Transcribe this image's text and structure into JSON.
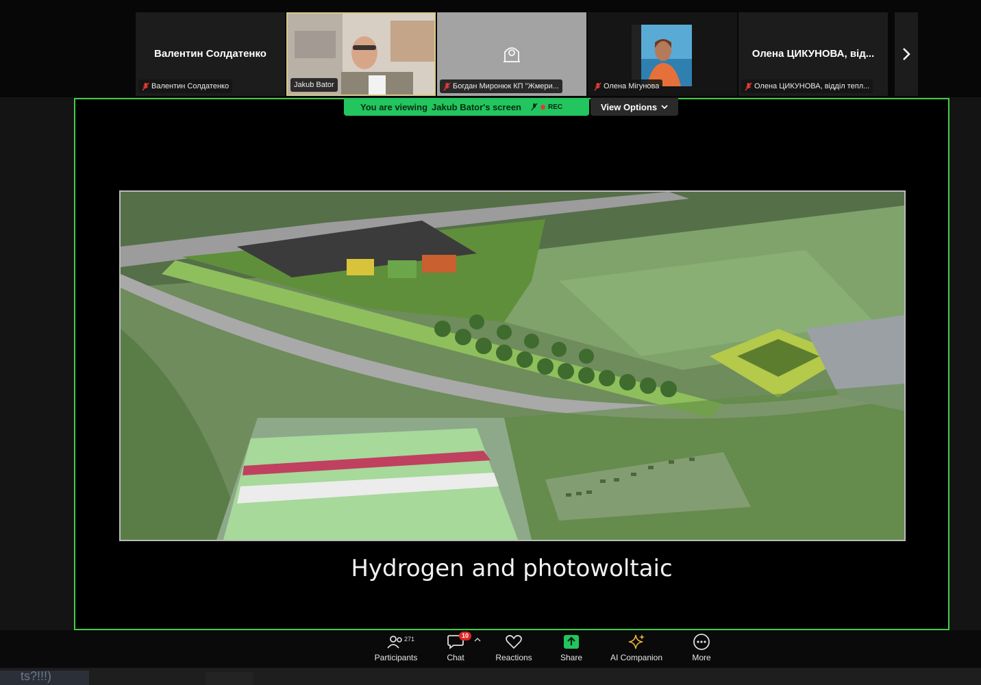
{
  "participants": [
    {
      "big_name": "Валентин Солдатенко",
      "label": "Валентин Солдатенко",
      "muted": true,
      "has_video": false
    },
    {
      "big_name": "",
      "label": "Jakub Bator",
      "muted": false,
      "has_video": true,
      "active": true
    },
    {
      "big_name": "",
      "label": "Богдан Миронюк КП \"Жмери...",
      "muted": true,
      "has_video": false
    },
    {
      "big_name": "",
      "label": "Олена Мігунова",
      "muted": true,
      "has_video": true
    },
    {
      "big_name": "Олена ЦИКУНОВА, від...",
      "label": "Олена ЦИКУНОВА, відділ тепл...",
      "muted": true,
      "has_video": false
    }
  ],
  "share_bar": {
    "viewing": "You are viewing",
    "who": "Jakub Bator's screen",
    "rec": "REC",
    "view_options": "View Options"
  },
  "slide": {
    "title": "Hydrogen and photowoltaic"
  },
  "toolbar": {
    "participants_label": "Participants",
    "participants_count": "271",
    "chat_label": "Chat",
    "chat_badge": "10",
    "reactions_label": "Reactions",
    "share_label": "Share",
    "ai_label": "AI Companion",
    "more_label": "More"
  },
  "bottom_strip": {
    "text": "ts?!!!)"
  },
  "colors": {
    "accent_green": "#22c55e",
    "screen_border": "#3fd04a",
    "badge_red": "#e02424",
    "ai_gold": "#e5b53c"
  }
}
